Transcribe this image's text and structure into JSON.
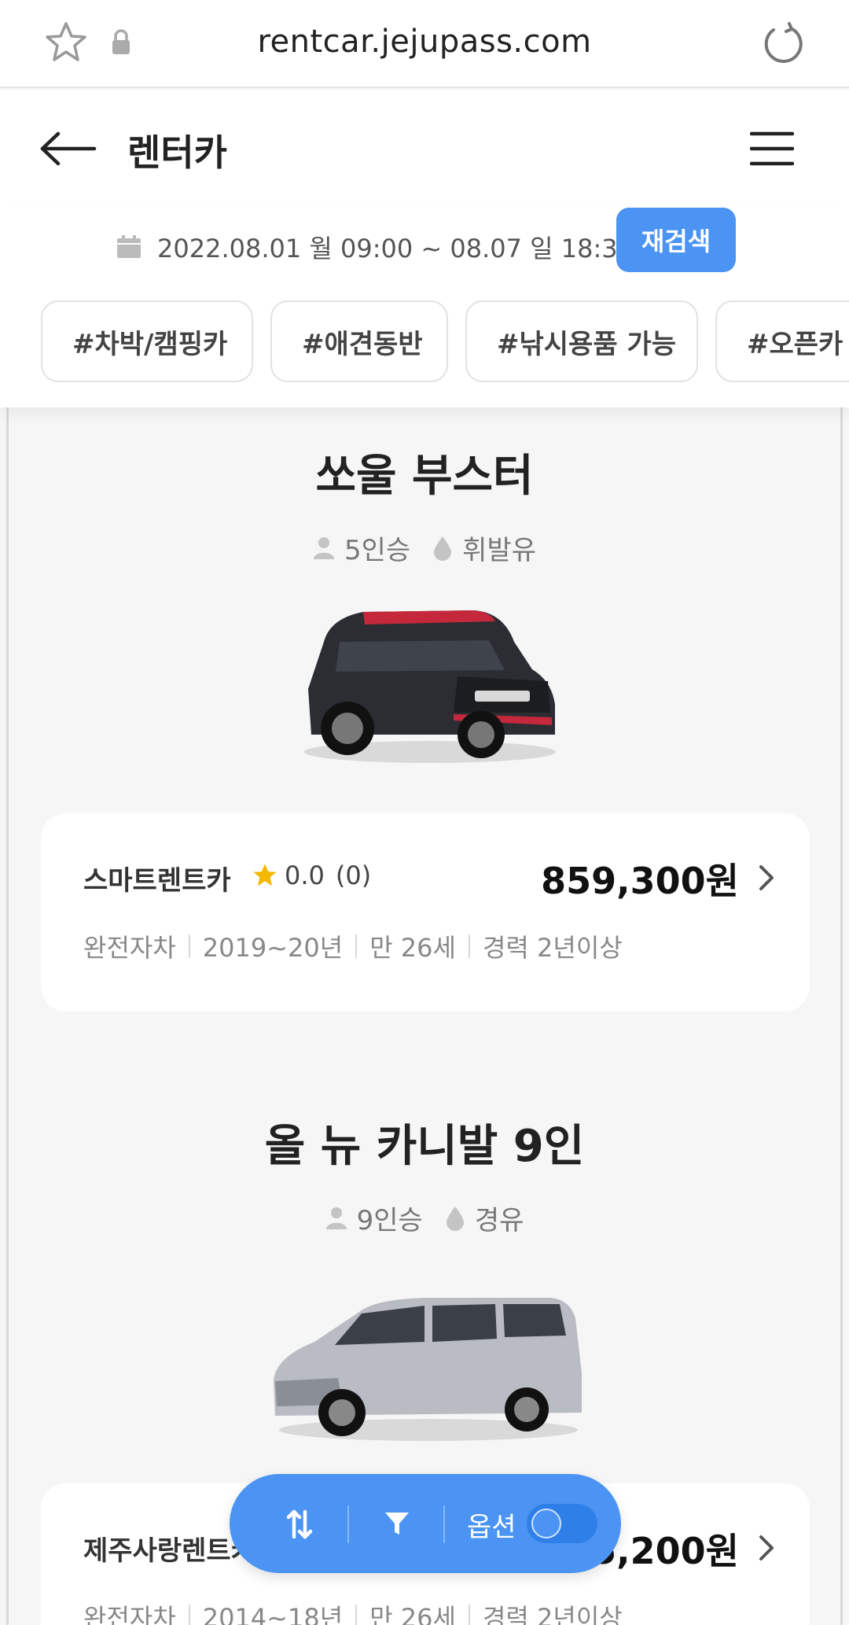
{
  "browser": {
    "url": "rentcar.jejupass.com"
  },
  "header": {
    "title": "렌터카"
  },
  "search": {
    "date_range": "2022.08.01 월 09:00 ~ 08.07 일 18:30",
    "research_label": "재검색"
  },
  "tags": [
    "#차박/캠핑카",
    "#애견동반",
    "#낚시용품 가능",
    "#오픈카"
  ],
  "cars": [
    {
      "name": "쏘울 부스터",
      "seats": "5인승",
      "fuel": "휘발유",
      "company": "스마트렌트카",
      "rating": "0.0",
      "reviews": "(0)",
      "price": "859,300원",
      "info": [
        "완전자차",
        "2019~20년",
        "만 26세",
        "경력 2년이상"
      ]
    },
    {
      "name": "올 뉴 카니발 9인",
      "seats": "9인승",
      "fuel": "경유",
      "company": "제주사랑렌트카",
      "rating": "",
      "reviews": "",
      "price": "5,200원",
      "info": [
        "완전자차",
        "2014~18년",
        "만 26세",
        "경력 2년이상"
      ]
    }
  ],
  "bottom_bar": {
    "option_label": "옵션",
    "toggle_on": false
  },
  "colors": {
    "accent": "#4b94f3",
    "star": "#f5b800"
  }
}
